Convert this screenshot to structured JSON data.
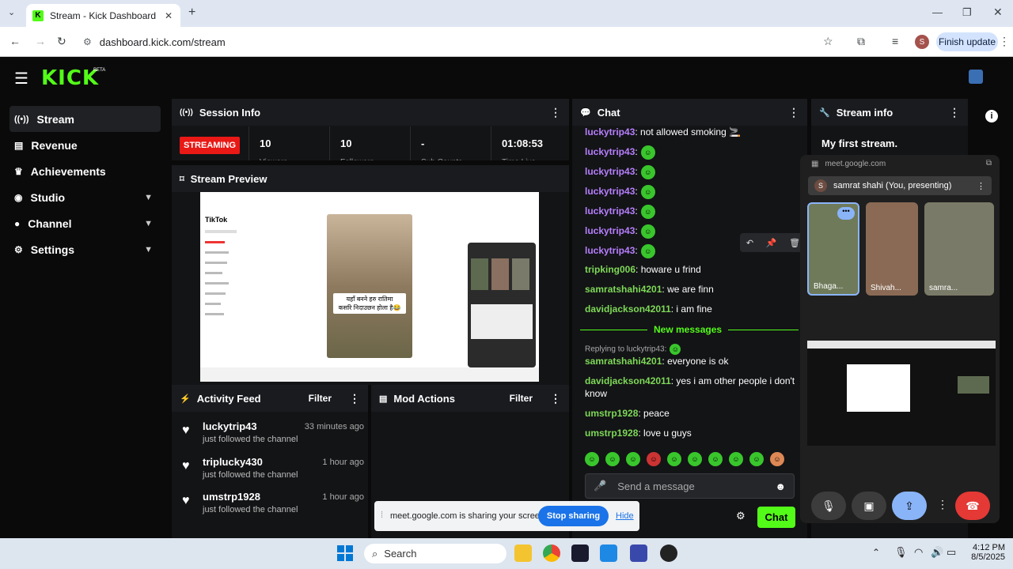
{
  "browser": {
    "tab_title": "Stream - Kick Dashboard",
    "url": "dashboard.kick.com/stream",
    "finish_update": "Finish update",
    "avatar_initial": "S"
  },
  "header": {
    "logo": "KICK",
    "beta": "BETA"
  },
  "sidebar": {
    "items": [
      {
        "label": "Stream"
      },
      {
        "label": "Revenue"
      },
      {
        "label": "Achievements"
      },
      {
        "label": "Studio"
      },
      {
        "label": "Channel"
      },
      {
        "label": "Settings"
      }
    ]
  },
  "session": {
    "title": "Session Info",
    "status": "STREAMING",
    "viewers": "10",
    "viewers_label": "Viewers",
    "followers": "10",
    "followers_label": "Followers",
    "subs": "-",
    "subs_label": "Sub Counts",
    "time": "01:08:53",
    "time_label": "Time Live"
  },
  "preview": {
    "title": "Stream Preview",
    "caption_line1": "यहाँ बनने हरु रातिमा",
    "caption_line2": "कसरि निदाउछन होला है😂",
    "app": "TikTok"
  },
  "activity": {
    "title": "Activity Feed",
    "filter": "Filter",
    "items": [
      {
        "name": "luckytrip43",
        "sub": "just followed the channel",
        "time": "33 minutes ago"
      },
      {
        "name": "triplucky430",
        "sub": "just followed the channel",
        "time": "1 hour ago"
      },
      {
        "name": "umstrp1928",
        "sub": "just followed the channel",
        "time": "1 hour ago"
      }
    ]
  },
  "mod": {
    "title": "Mod Actions",
    "filter": "Filter"
  },
  "chat": {
    "title": "Chat",
    "messages": [
      {
        "user": "luckytrip43",
        "text": ": not allowed smoking 🚬"
      },
      {
        "user": "luckytrip43",
        "text": ":"
      },
      {
        "user": "luckytrip43",
        "text": ":"
      },
      {
        "user": "luckytrip43",
        "text": ":"
      },
      {
        "user": "luckytrip43",
        "text": ":"
      },
      {
        "user": "luckytrip43",
        "text": ":"
      },
      {
        "user": "luckytrip43",
        "text": ":"
      },
      {
        "user": "tripking006",
        "text": ": howare u frind"
      },
      {
        "user": "samratshahi4201",
        "text": ": we are finn"
      },
      {
        "user": "davidjackson42011",
        "text": ": i am fine"
      }
    ],
    "new_messages": "New messages",
    "reply_to": "Replying to luckytrip43:",
    "messages2": [
      {
        "user": "samratshahi4201",
        "text": ": everyone is ok"
      },
      {
        "user": "davidjackson42011",
        "text": ": yes i am other people i don't"
      },
      {
        "user": "",
        "text": "know"
      },
      {
        "user": "umstrp1928",
        "text": ": peace"
      },
      {
        "user": "umstrp1928",
        "text": ": love u guys"
      }
    ],
    "placeholder": "Send a message",
    "send": "Chat"
  },
  "stream_info": {
    "title": "Stream info",
    "stream_title": "My first stream."
  },
  "meet": {
    "domain": "meet.google.com",
    "presenter": "samrat shahi (You, presenting)",
    "presenter_initial": "S",
    "tiles": [
      {
        "name": "Bhaga..."
      },
      {
        "name": "Shivah..."
      },
      {
        "name": "samra..."
      }
    ]
  },
  "share_bar": {
    "text": "meet.google.com is sharing your screen.",
    "stop": "Stop sharing",
    "hide": "Hide"
  },
  "taskbar": {
    "search": "Search",
    "time": "4:12 PM",
    "date": "8/5/2025"
  }
}
